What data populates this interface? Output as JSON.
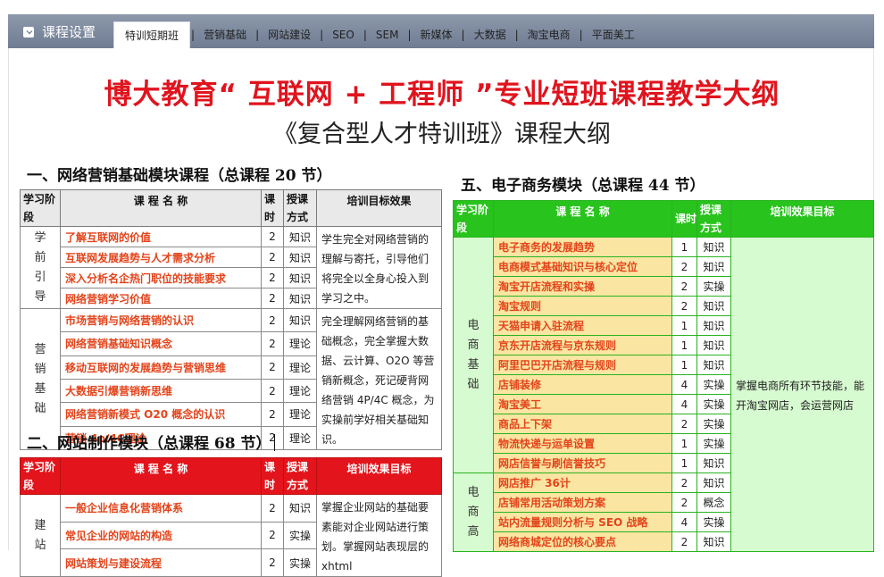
{
  "header": {
    "title": "课程设置",
    "icon": "checkbox-icon",
    "tabs": [
      "特训短期班",
      "营销基础",
      "网站建设",
      "SEO",
      "SEM",
      "新媒体",
      "大数据",
      "淘宝电商",
      "平面美工"
    ]
  },
  "doc": {
    "title": "博大教育“ 互联网 + 工程师 ”专业短班课程教学大纲",
    "subtitle": "《复合型人才特训班》课程大纲",
    "headers": {
      "stage": "学习阶段",
      "name": "课 程 名 称",
      "hours": "课时",
      "method": "授课方式",
      "goal1": "培训目标效果",
      "goal2": "培训效果目标"
    },
    "sec1": {
      "title": "一、网络营销基础模块课程（总课程 20 节）",
      "groups": [
        {
          "label": "学前引导",
          "goal": "学生完全对网络营销的理解与寄托，引导他们将完全以全身心投入到学习之中。",
          "rows": [
            [
              "了解互联网的价值",
              "2",
              "知识"
            ],
            [
              "互联网发展趋势与人才需求分析",
              "2",
              "知识"
            ],
            [
              "深入分析名企热门职位的技能要求",
              "2",
              "知识"
            ],
            [
              "网络营销学习价值",
              "2",
              "知识"
            ]
          ]
        },
        {
          "label": "营销基础",
          "goal": "完全理解网络营销的基础概念，完全掌握大数据、云计算、O2O 等营销新概念，死记硬背网络营销 4P/4C 概念，为实操前学好相关基础知识。",
          "rows": [
            [
              "市场营销与网络营销的认识",
              "2",
              "知识"
            ],
            [
              "网络营销基础知识概念",
              "2",
              "理论"
            ],
            [
              "移动互联网的发展趋势与营销思维",
              "2",
              "理论"
            ],
            [
              "大数据引爆营销新思维",
              "2",
              "理论"
            ],
            [
              "网络营销新模式 O20 概念的认识",
              "2",
              "理论"
            ],
            [
              "营销 4p/4C理论",
              "2",
              "理论"
            ]
          ]
        }
      ]
    },
    "sec2": {
      "title": "二、网站制作模块（总课程 68 节）",
      "groups": [
        {
          "label": "建站",
          "goal": "掌握企业网站的基础要素能对企业网站进行策划。掌握网站表现层的 xhtml",
          "rows": [
            [
              "一般企业信息化营销体系",
              "2",
              "知识"
            ],
            [
              "常见企业的网站的构造",
              "2",
              "实操"
            ],
            [
              "网站策划与建设流程",
              "2",
              "实操"
            ]
          ]
        }
      ]
    },
    "sec5": {
      "title": "五、电子商务模块（总课程 44 节）",
      "goal": "掌握电商所有环节技能，能开淘宝网店，会运营网店",
      "groups": [
        {
          "label": "电商基础",
          "rows": [
            [
              "电子商务的发展趋势",
              "1",
              "知识"
            ],
            [
              "电商模式基础知识与核心定位",
              "2",
              "知识"
            ],
            [
              "淘宝开店流程和实操",
              "2",
              "实操"
            ],
            [
              "淘宝规则",
              "2",
              "知识"
            ],
            [
              "天猫申请入驻流程",
              "1",
              "知识"
            ],
            [
              "京东开店流程与京东规则",
              "1",
              "知识"
            ],
            [
              "阿里巴巴开店流程与规则",
              "1",
              "知识"
            ],
            [
              "店铺装修",
              "4",
              "实操"
            ],
            [
              "淘宝美工",
              "4",
              "实操"
            ],
            [
              "商品上下架",
              "2",
              "实操"
            ],
            [
              "物流快递与运单设置",
              "1",
              "实操"
            ],
            [
              "网店信誉与刷信誉技巧",
              "1",
              "知识"
            ]
          ]
        },
        {
          "label": "电商高",
          "rows": [
            [
              "网店推广 36计",
              "2",
              "知识"
            ],
            [
              "店铺常用活动策划方案",
              "2",
              "概念"
            ],
            [
              "站内流量规则分析与 SEO 战略",
              "4",
              "实操"
            ],
            [
              "网络商城定位的核心要点",
              "2",
              "知识"
            ]
          ]
        }
      ]
    }
  }
}
